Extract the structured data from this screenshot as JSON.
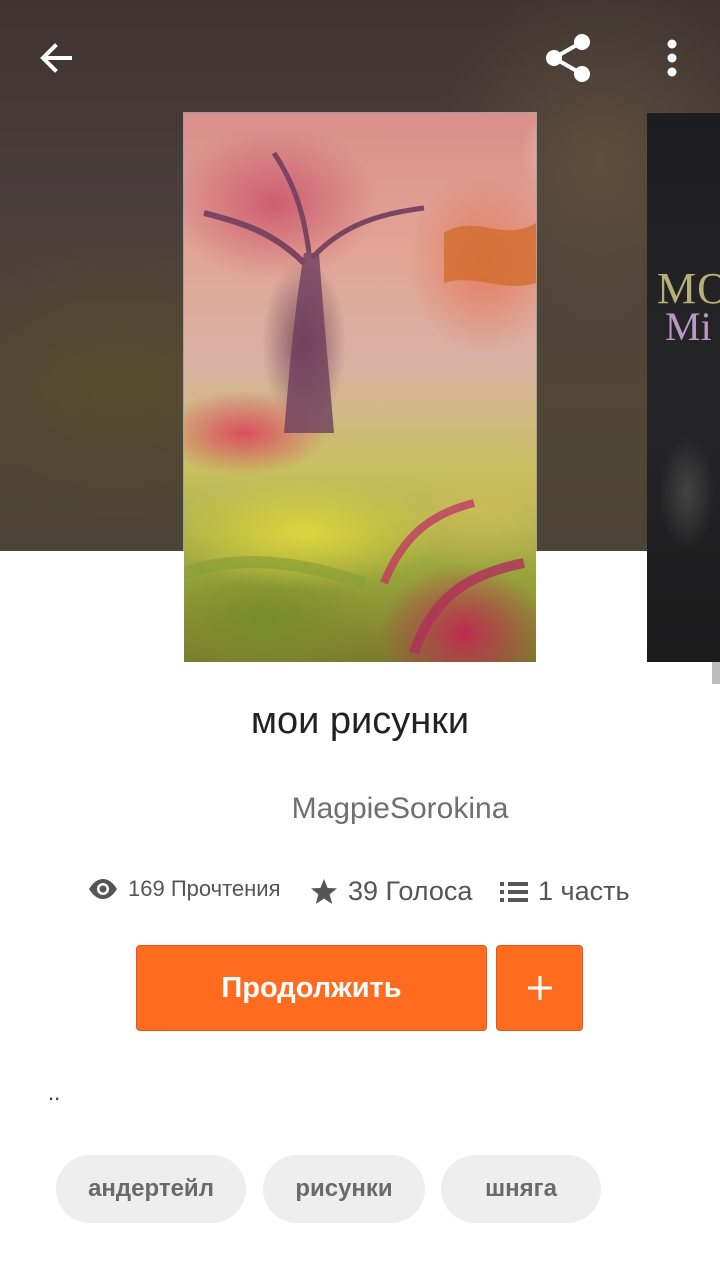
{
  "header": {
    "back_icon": "arrow-left-icon",
    "share_icon": "share-icon",
    "more_icon": "more-vertical-icon"
  },
  "story": {
    "title": "мои рисунки",
    "author": "MagpieSorokina",
    "stats": {
      "reads": "169 Прочтения",
      "votes": "39 Голоса",
      "parts": "1 часть"
    },
    "description": ".."
  },
  "next_cover": {
    "line1": "MONS",
    "line2": "Mi"
  },
  "actions": {
    "continue_label": "Продолжить",
    "add_icon": "plus-icon"
  },
  "tags": [
    "андертейл",
    "рисунки",
    "шняга"
  ],
  "colors": {
    "accent": "#ff6c1f",
    "tag_bg": "#eeeeee",
    "title_text": "#222222"
  }
}
